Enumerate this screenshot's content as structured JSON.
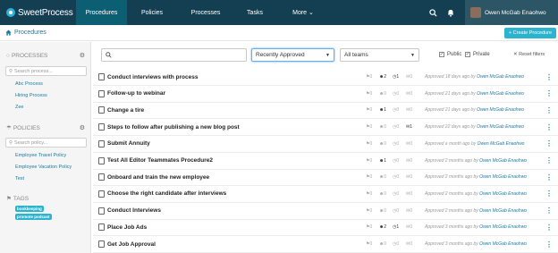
{
  "nav": {
    "logo": "SweetProcess",
    "tabs": [
      "Procedures",
      "Policies",
      "Processes",
      "Tasks",
      "More ⌄"
    ],
    "user": "Owen McGab Enaohwo"
  },
  "subheader": {
    "breadcrumb": "Procedures",
    "create_button": "+ Create Procedure"
  },
  "sidebar": {
    "processes_heading": "PROCESSES",
    "process_search_placeholder": "Search process...",
    "processes": [
      "Abc Process",
      "Hiring Process",
      "Zee"
    ],
    "policies_heading": "POLICIES",
    "policy_search_placeholder": "Search policy...",
    "policies": [
      "Employee Travel Policy",
      "Employee Vacation Policy",
      "Test"
    ],
    "tags_heading": "TAGS",
    "tags": [
      "bookkeeping",
      "promote podcast"
    ]
  },
  "filters": {
    "search_placeholder": "",
    "sort": "Recently Approved",
    "team": "All teams",
    "public_label": "Public",
    "private_label": "Private",
    "reset_label": "Reset filters"
  },
  "procedures": [
    {
      "title": "Conduct interviews with process",
      "s1": "0",
      "s2": "2",
      "s3": "1",
      "s4": "0",
      "approved": "Approved 18 days ago by ",
      "by": "Owen McGab Enaohwo"
    },
    {
      "title": "Follow-up to webinar",
      "s1": "0",
      "s2": "0",
      "s3": "0",
      "s4": "0",
      "approved": "Approved 21 days ago by ",
      "by": "Owen McGab Enaohwo"
    },
    {
      "title": "Change a tire",
      "s1": "0",
      "s2": "1",
      "s3": "0",
      "s4": "0",
      "approved": "Approved 21 days ago by ",
      "by": "Owen McGab Enaohwo"
    },
    {
      "title": "Steps to follow after publishing a new blog post",
      "s1": "0",
      "s2": "0",
      "s3": "0",
      "s4": "1",
      "approved": "Approved 22 days ago by ",
      "by": "Owen McGab Enaohwo"
    },
    {
      "title": "Submit Annuity",
      "s1": "0",
      "s2": "0",
      "s3": "0",
      "s4": "0",
      "approved": "Approved a month ago by ",
      "by": "Owen McGab Enaohwo"
    },
    {
      "title": "Test All Editor Teammates Procedure2",
      "s1": "0",
      "s2": "1",
      "s3": "0",
      "s4": "0",
      "approved": "Approved 2 months ago by ",
      "by": "Owen McGab Enaohwo"
    },
    {
      "title": "Onboard and train the new employee",
      "s1": "0",
      "s2": "0",
      "s3": "0",
      "s4": "0",
      "approved": "Approved 2 months ago by ",
      "by": "Owen McGab Enaohwo"
    },
    {
      "title": "Choose the right candidate after interviews",
      "s1": "0",
      "s2": "0",
      "s3": "0",
      "s4": "0",
      "approved": "Approved 2 months ago by ",
      "by": "Owen McGab Enaohwo"
    },
    {
      "title": "Conduct Interviews",
      "s1": "0",
      "s2": "0",
      "s3": "0",
      "s4": "0",
      "approved": "Approved 2 months ago by ",
      "by": "Owen McGab Enaohwo"
    },
    {
      "title": "Place Job Ads",
      "s1": "0",
      "s2": "2",
      "s3": "1",
      "s4": "0",
      "approved": "Approved 3 months ago by ",
      "by": "Owen McGab Enaohwo"
    },
    {
      "title": "Get Job Approval",
      "s1": "0",
      "s2": "0",
      "s3": "0",
      "s4": "0",
      "approved": "Approved 3 months ago by ",
      "by": "Owen McGab Enaohwo"
    }
  ],
  "colors": {
    "nav_bg": "#143f52",
    "accent": "#2bb4cf",
    "link": "#1b7aa3"
  }
}
